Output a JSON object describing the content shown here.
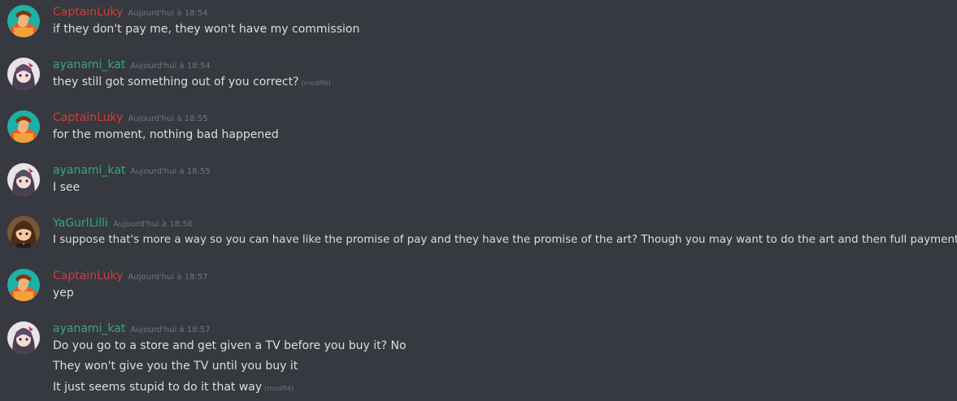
{
  "colors": {
    "background": "#36393f",
    "text": "#dcddde",
    "muted": "#72767d",
    "captain": "#d33b3b",
    "ayanami": "#3aa776",
    "yagurl": "#3aa776"
  },
  "messages": [
    {
      "author": "CaptainLuky",
      "avatar_icon": "captainluky-avatar-icon",
      "timestamp": "Aujourd'hui à 18:54",
      "lines": [
        {
          "text": "if they don't pay me, they won't have my commission",
          "edited": ""
        }
      ]
    },
    {
      "author": "ayanami_kat",
      "avatar_icon": "ayanami-kat-avatar-icon",
      "timestamp": "Aujourd'hui à 18:54",
      "lines": [
        {
          "text": "they still got something out of you correct?",
          "edited": "(modifié)"
        }
      ]
    },
    {
      "author": "CaptainLuky",
      "avatar_icon": "captainluky-avatar-icon",
      "timestamp": "Aujourd'hui à 18:55",
      "lines": [
        {
          "text": "for the moment, nothing bad happened",
          "edited": ""
        }
      ]
    },
    {
      "author": "ayanami_kat",
      "avatar_icon": "ayanami-kat-avatar-icon",
      "timestamp": "Aujourd'hui à 18:55",
      "lines": [
        {
          "text": "I see",
          "edited": ""
        }
      ]
    },
    {
      "author": "YaGurlLilli",
      "avatar_icon": "yagurllilli-avatar-icon",
      "timestamp": "Aujourd'hui à 18:56",
      "lines": [
        {
          "text": "I suppose that's more a way so you can have like the promise of pay and they have the promise of the art? Though you may want to do the art and then full payment?",
          "edited": ""
        }
      ]
    },
    {
      "author": "CaptainLuky",
      "avatar_icon": "captainluky-avatar-icon",
      "timestamp": "Aujourd'hui à 18:57",
      "lines": [
        {
          "text": "yep",
          "edited": ""
        }
      ]
    },
    {
      "author": "ayanami_kat",
      "avatar_icon": "ayanami-kat-avatar-icon",
      "timestamp": "Aujourd'hui à 18:57",
      "lines": [
        {
          "text": "Do you go to a store and get given a TV before you buy it? No",
          "edited": ""
        },
        {
          "text": "They won't give you the TV until you buy it",
          "edited": ""
        },
        {
          "text": "It just seems stupid to do it that way",
          "edited": "(modifié)"
        }
      ]
    }
  ]
}
